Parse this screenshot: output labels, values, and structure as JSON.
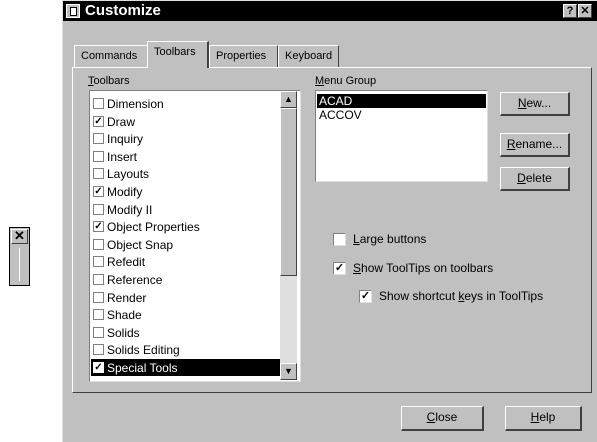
{
  "mini_toolbar": {
    "close_glyph": "✕"
  },
  "dialog": {
    "title": "Customize",
    "title_buttons": {
      "help": "?",
      "close": "✕"
    },
    "tabs": [
      "Commands",
      "Toolbars",
      "Properties",
      "Keyboard"
    ],
    "active_tab": "Toolbars",
    "toolbars_label": {
      "accel": "T",
      "rest": "oolbars"
    },
    "toolbars": [
      {
        "label": "Dimension",
        "checked": false
      },
      {
        "label": "Draw",
        "checked": true
      },
      {
        "label": "Inquiry",
        "checked": false
      },
      {
        "label": "Insert",
        "checked": false
      },
      {
        "label": "Layouts",
        "checked": false
      },
      {
        "label": "Modify",
        "checked": true
      },
      {
        "label": "Modify II",
        "checked": false
      },
      {
        "label": "Object Properties",
        "checked": true
      },
      {
        "label": "Object Snap",
        "checked": false
      },
      {
        "label": "Refedit",
        "checked": false
      },
      {
        "label": "Reference",
        "checked": false
      },
      {
        "label": "Render",
        "checked": false
      },
      {
        "label": "Shade",
        "checked": false
      },
      {
        "label": "Solids",
        "checked": false
      },
      {
        "label": "Solids Editing",
        "checked": false
      },
      {
        "label": "Special Tools",
        "checked": true,
        "selected": true
      }
    ],
    "menu_group_label": {
      "accel": "M",
      "rest": "enu Group"
    },
    "menu_groups": [
      {
        "label": "ACAD",
        "selected": true
      },
      {
        "label": "ACCOV",
        "selected": false
      }
    ],
    "buttons": {
      "new": {
        "accel": "N",
        "rest": "ew..."
      },
      "rename": {
        "accel": "R",
        "rest": "ename..."
      },
      "delete": {
        "accel": "D",
        "rest": "elete"
      },
      "close": {
        "accel": "C",
        "rest": "lose"
      },
      "help": {
        "accel": "H",
        "rest": "elp"
      }
    },
    "options": {
      "large_buttons": {
        "pre": "",
        "accel": "L",
        "post": "arge buttons",
        "checked": false
      },
      "show_tooltips": {
        "pre": "",
        "accel": "S",
        "post": "how ToolTips on toolbars",
        "checked": true
      },
      "show_shortcut_keys": {
        "pre": "Show shortcut ",
        "accel": "k",
        "post": "eys in ToolTips",
        "checked": true
      }
    },
    "check_glyph": "✓",
    "scroll_up_glyph": "▲",
    "scroll_down_glyph": "▼"
  }
}
